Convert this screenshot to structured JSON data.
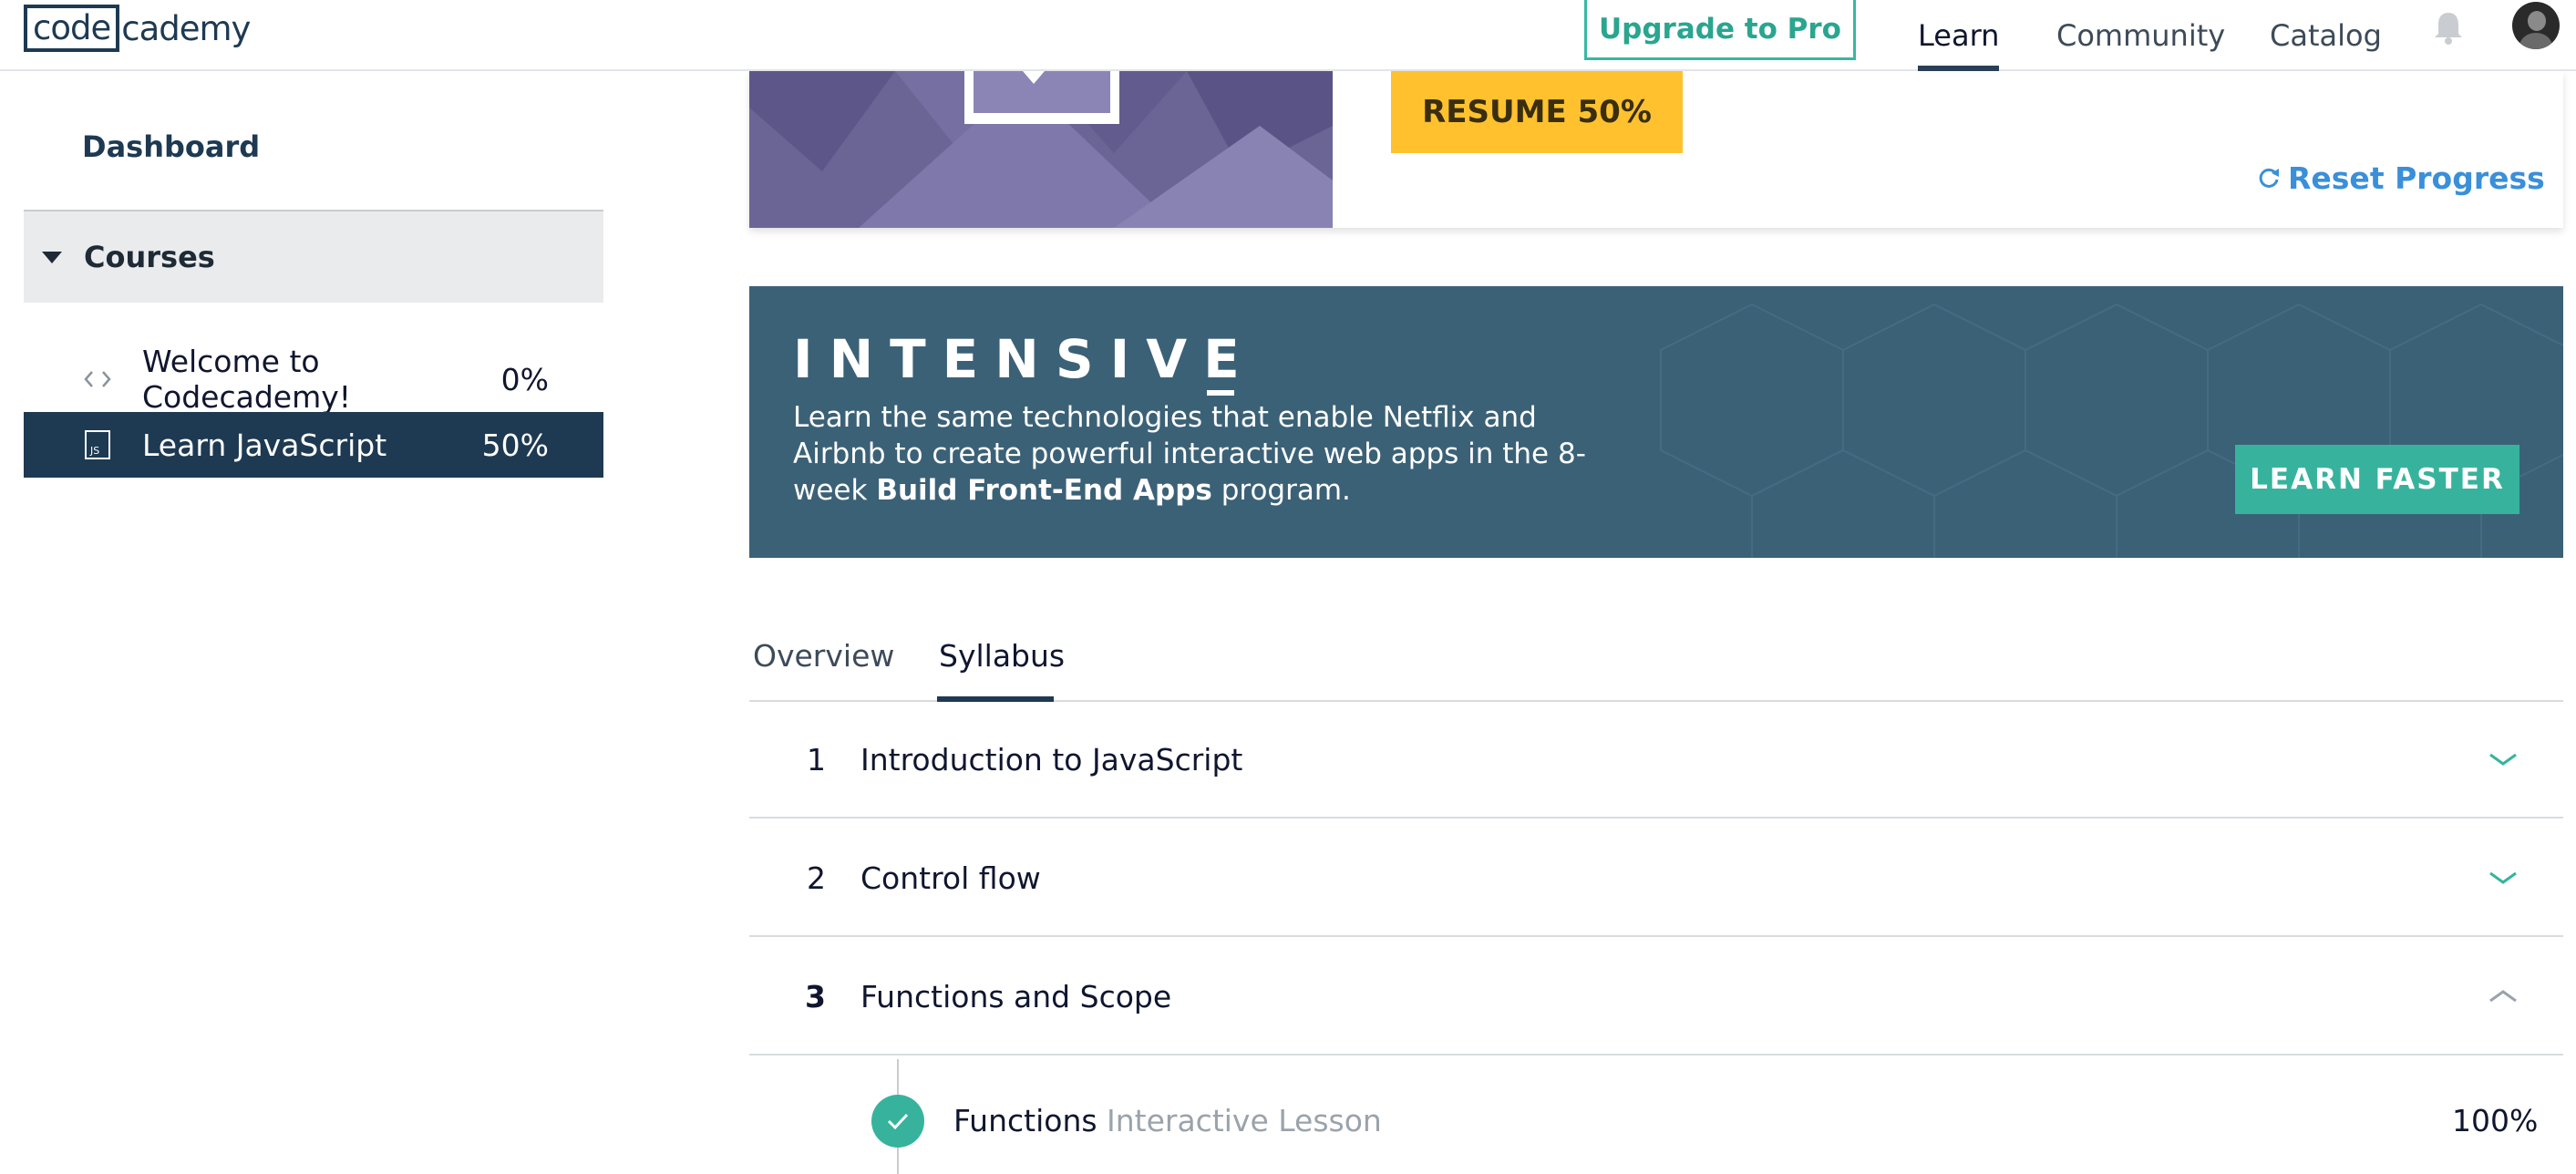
{
  "header": {
    "logo_box": "code",
    "logo_rest": "cademy",
    "upgrade_label": "Upgrade to Pro",
    "nav": [
      {
        "label": "Learn",
        "active": true
      },
      {
        "label": "Community",
        "active": false
      },
      {
        "label": "Catalog",
        "active": false
      }
    ],
    "icons": [
      "bell-icon",
      "avatar"
    ]
  },
  "sidebar": {
    "dashboard_label": "Dashboard",
    "courses_label": "Courses",
    "courses": [
      {
        "icon": "code-brackets-icon",
        "name": "Welcome to Codecademy!",
        "progress": "0%",
        "selected": false
      },
      {
        "icon": "js-file-icon",
        "name": "Learn JavaScript",
        "progress": "50%",
        "selected": true
      }
    ]
  },
  "course_card": {
    "resume_label": "RESUME 50%",
    "reset_label": "Reset Progress"
  },
  "banner": {
    "title": "INTENSIVE",
    "text_plain": "Learn the same technologies that enable Netflix and Airbnb to create powerful interactive web apps in the 8-week ",
    "text_bold": "Build Front-End Apps",
    "text_end": " program.",
    "cta_label": "LEARN FASTER"
  },
  "tabs": [
    {
      "label": "Overview",
      "active": false
    },
    {
      "label": "Syllabus",
      "active": true
    }
  ],
  "syllabus": [
    {
      "num": "1",
      "title": "Introduction to JavaScript",
      "expanded": false
    },
    {
      "num": "2",
      "title": "Control flow",
      "expanded": false
    },
    {
      "num": "3",
      "title": "Functions and Scope",
      "expanded": true
    }
  ],
  "lesson": {
    "name": "Functions",
    "type": "Interactive Lesson",
    "progress": "100%",
    "completed": true
  },
  "colors": {
    "brand_navy": "#1e3a52",
    "teal": "#37b39d",
    "resume_yellow": "#ffc22e",
    "link_blue": "#3a8fd9",
    "banner_bg": "#3b6177"
  }
}
